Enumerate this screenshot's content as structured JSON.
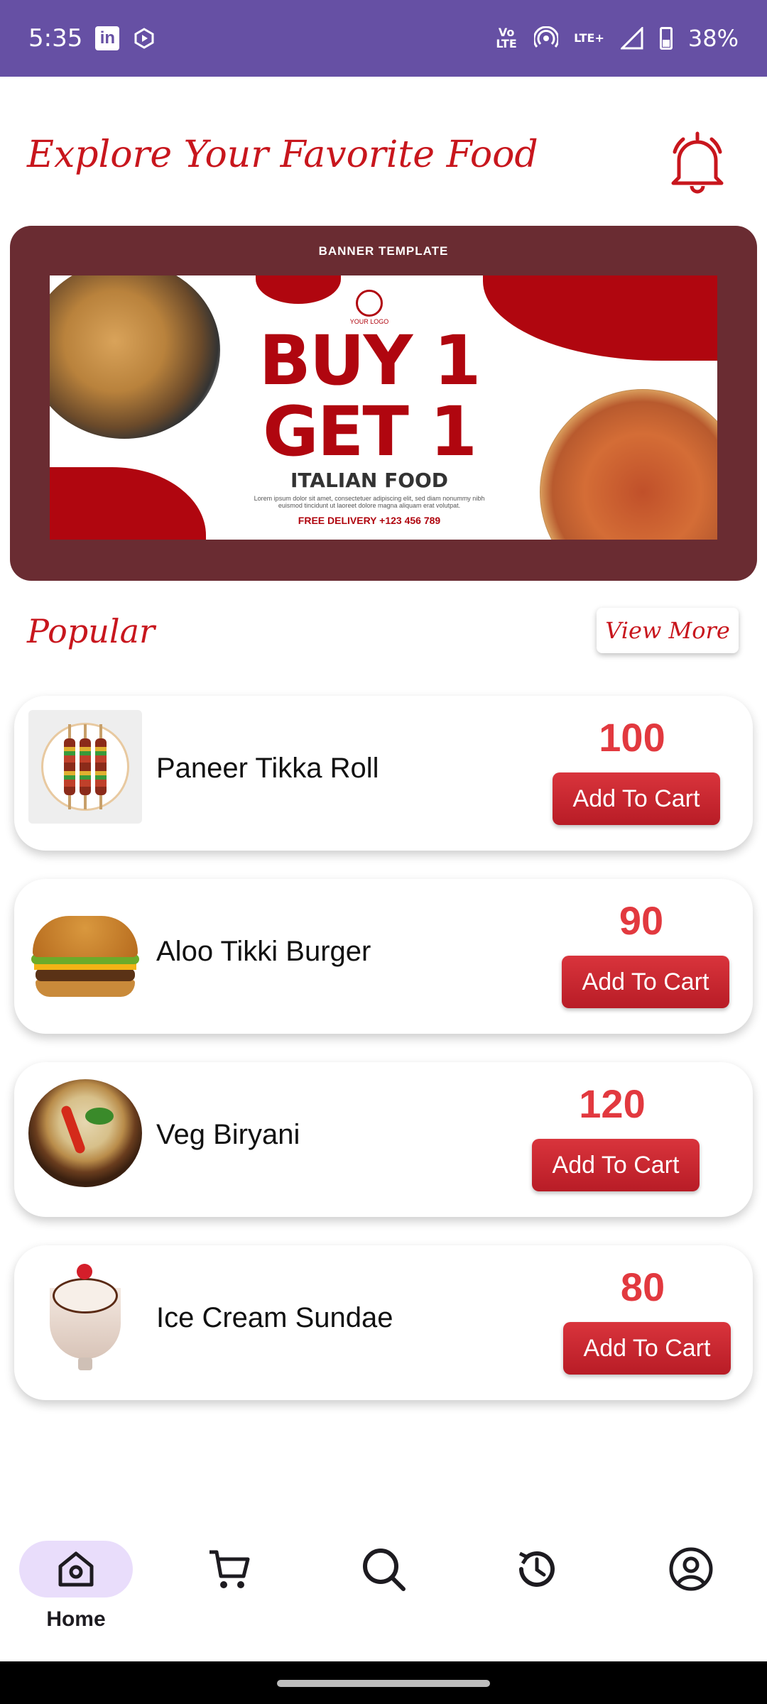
{
  "status_bar": {
    "time": "5:35",
    "battery": "38%",
    "network_label": "LTE+",
    "volte_label": "Vo LTE",
    "icons": [
      "linkedin-icon",
      "play-icon",
      "volte-icon",
      "hotspot-icon",
      "signal-icon",
      "battery-icon"
    ]
  },
  "header": {
    "title": "Explore Your Favorite Food",
    "bell_icon": "bell-icon"
  },
  "banner": {
    "label": "BANNER TEMPLATE",
    "logo_text": "YOUR LOGO",
    "line1": "BUY 1",
    "line2": "GET 1",
    "subtitle": "ITALIAN FOOD",
    "body": "Lorem ipsum dolor sit amet, consectetuer adipiscing elit, sed diam nonummy nibh euismod tincidunt ut laoreet dolore magna aliquam erat volutpat.",
    "delivery": "FREE DELIVERY +123 456 789"
  },
  "popular": {
    "title": "Popular",
    "view_more": "View More"
  },
  "items": [
    {
      "name": "Paneer Tikka Roll",
      "price": "100",
      "button": "Add To Cart"
    },
    {
      "name": "Aloo Tikki Burger",
      "price": "90",
      "button": "Add To Cart"
    },
    {
      "name": "Veg Biryani",
      "price": "120",
      "button": "Add To Cart"
    },
    {
      "name": "Ice Cream Sundae",
      "price": "80",
      "button": "Add To Cart"
    }
  ],
  "bottom_nav": {
    "items": [
      {
        "label": "Home",
        "icon": "home-icon",
        "active": true
      },
      {
        "label": "",
        "icon": "cart-icon",
        "active": false
      },
      {
        "label": "",
        "icon": "search-icon",
        "active": false
      },
      {
        "label": "",
        "icon": "history-icon",
        "active": false
      },
      {
        "label": "",
        "icon": "profile-icon",
        "active": false
      }
    ]
  },
  "colors": {
    "status_bar": "#6650a4",
    "accent_red": "#c8161d",
    "price_red": "#e2393f",
    "banner_bg": "#6a2c32",
    "nav_active_pill": "#e9ddfb"
  }
}
